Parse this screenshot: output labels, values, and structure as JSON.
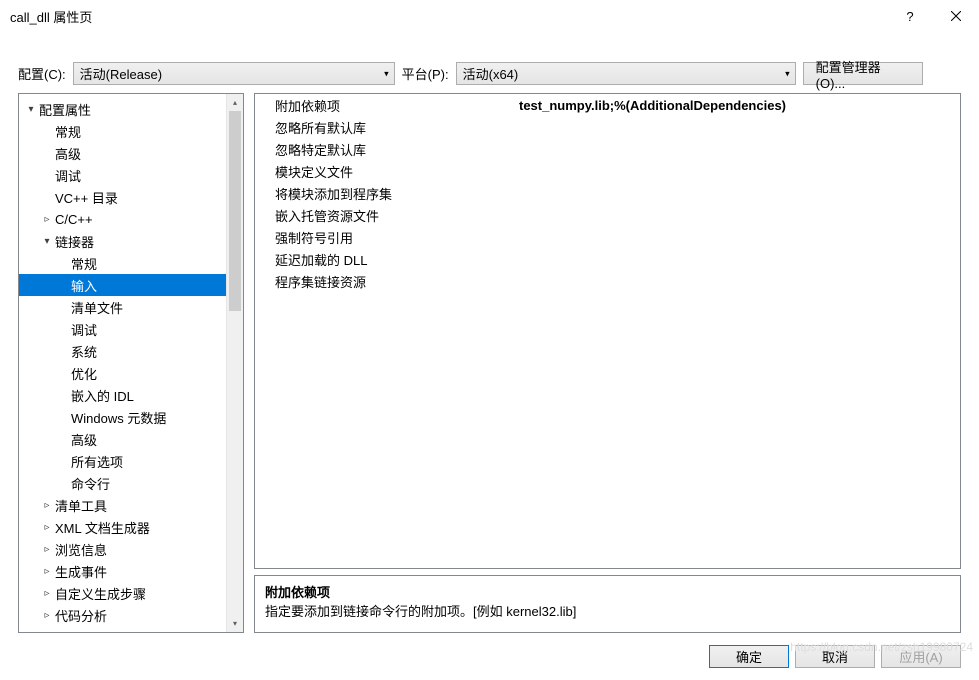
{
  "titlebar": {
    "title": "call_dll 属性页"
  },
  "toolbar": {
    "config_label": "配置(C):",
    "config_value": "活动(Release)",
    "platform_label": "平台(P):",
    "platform_value": "活动(x64)",
    "manager_btn": "配置管理器(O)..."
  },
  "tree": [
    {
      "label": "配置属性",
      "depth": 0,
      "expander": "▾"
    },
    {
      "label": "常规",
      "depth": 1,
      "expander": ""
    },
    {
      "label": "高级",
      "depth": 1,
      "expander": ""
    },
    {
      "label": "调试",
      "depth": 1,
      "expander": ""
    },
    {
      "label": "VC++ 目录",
      "depth": 1,
      "expander": ""
    },
    {
      "label": "C/C++",
      "depth": 1,
      "expander": "▹"
    },
    {
      "label": "链接器",
      "depth": 1,
      "expander": "▾"
    },
    {
      "label": "常规",
      "depth": 2,
      "expander": ""
    },
    {
      "label": "输入",
      "depth": 2,
      "expander": "",
      "selected": true
    },
    {
      "label": "清单文件",
      "depth": 2,
      "expander": ""
    },
    {
      "label": "调试",
      "depth": 2,
      "expander": ""
    },
    {
      "label": "系统",
      "depth": 2,
      "expander": ""
    },
    {
      "label": "优化",
      "depth": 2,
      "expander": ""
    },
    {
      "label": "嵌入的 IDL",
      "depth": 2,
      "expander": ""
    },
    {
      "label": "Windows 元数据",
      "depth": 2,
      "expander": ""
    },
    {
      "label": "高级",
      "depth": 2,
      "expander": ""
    },
    {
      "label": "所有选项",
      "depth": 2,
      "expander": ""
    },
    {
      "label": "命令行",
      "depth": 2,
      "expander": ""
    },
    {
      "label": "清单工具",
      "depth": 1,
      "expander": "▹"
    },
    {
      "label": "XML 文档生成器",
      "depth": 1,
      "expander": "▹"
    },
    {
      "label": "浏览信息",
      "depth": 1,
      "expander": "▹"
    },
    {
      "label": "生成事件",
      "depth": 1,
      "expander": "▹"
    },
    {
      "label": "自定义生成步骤",
      "depth": 1,
      "expander": "▹"
    },
    {
      "label": "代码分析",
      "depth": 1,
      "expander": "▹"
    }
  ],
  "grid": [
    {
      "label": "附加依赖项",
      "value": "test_numpy.lib;%(AdditionalDependencies)"
    },
    {
      "label": "忽略所有默认库",
      "value": ""
    },
    {
      "label": "忽略特定默认库",
      "value": ""
    },
    {
      "label": "模块定义文件",
      "value": ""
    },
    {
      "label": "将模块添加到程序集",
      "value": ""
    },
    {
      "label": "嵌入托管资源文件",
      "value": ""
    },
    {
      "label": "强制符号引用",
      "value": ""
    },
    {
      "label": "延迟加载的 DLL",
      "value": ""
    },
    {
      "label": "程序集链接资源",
      "value": ""
    }
  ],
  "desc": {
    "title": "附加依赖项",
    "text": "指定要添加到链接命令行的附加项。[例如 kernel32.lib]"
  },
  "footer": {
    "ok": "确定",
    "cancel": "取消",
    "apply": "应用(A)"
  },
  "watermark": "https://blog.csdn.net/zsh19980724"
}
